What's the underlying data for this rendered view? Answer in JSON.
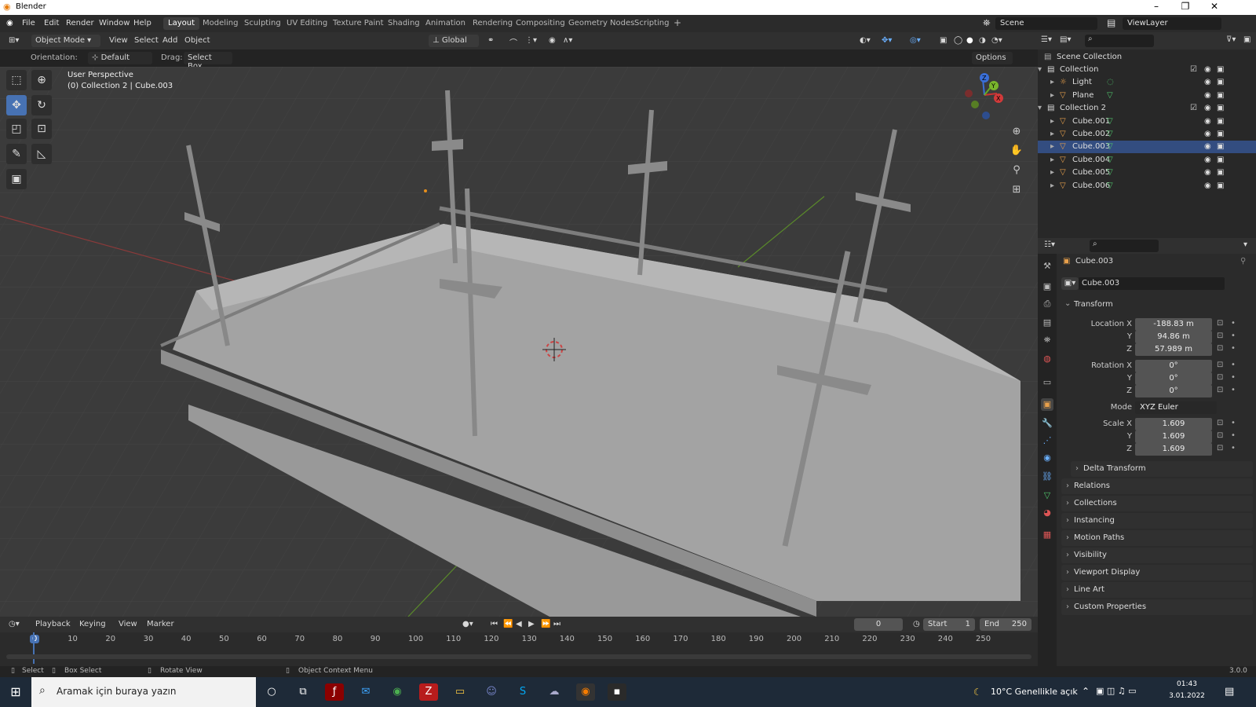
{
  "window": {
    "title": "Blender"
  },
  "menubar": [
    "File",
    "Edit",
    "Render",
    "Window",
    "Help"
  ],
  "workspaces": [
    "Layout",
    "Modeling",
    "Sculpting",
    "UV Editing",
    "Texture Paint",
    "Shading",
    "Animation",
    "Rendering",
    "Compositing",
    "Geometry Nodes",
    "Scripting"
  ],
  "workspace_add": "+",
  "scene": {
    "scene_name": "Scene",
    "view_layer": "ViewLayer"
  },
  "viewport_header": {
    "mode": "Object Mode",
    "menus": [
      "View",
      "Select",
      "Add",
      "Object"
    ],
    "transform_orientation": "Global",
    "orientation_label": "Orientation:",
    "orientation_value": "Default",
    "drag_label": "Drag:",
    "drag_value": "Select Box",
    "options_label": "Options"
  },
  "viewport": {
    "view_name": "User Perspective",
    "context": "(0) Collection 2 | Cube.003"
  },
  "outliner": {
    "root": "Scene Collection",
    "items": [
      {
        "name": "Collection",
        "level": 1,
        "kind": "collection"
      },
      {
        "name": "Light",
        "level": 2,
        "kind": "light"
      },
      {
        "name": "Plane",
        "level": 2,
        "kind": "mesh"
      },
      {
        "name": "Collection 2",
        "level": 1,
        "kind": "collection"
      },
      {
        "name": "Cube.001",
        "level": 2,
        "kind": "mesh"
      },
      {
        "name": "Cube.002",
        "level": 2,
        "kind": "mesh"
      },
      {
        "name": "Cube.003",
        "level": 2,
        "kind": "mesh",
        "selected": true
      },
      {
        "name": "Cube.004",
        "level": 2,
        "kind": "mesh"
      },
      {
        "name": "Cube.005",
        "level": 2,
        "kind": "mesh"
      },
      {
        "name": "Cube.006",
        "level": 2,
        "kind": "mesh"
      }
    ]
  },
  "properties": {
    "object_name": "Cube.003",
    "object_field": "Cube.003",
    "transform_label": "Transform",
    "location": {
      "label": "Location X",
      "x": "-188.83 m",
      "y": "94.86 m",
      "z": "57.989 m"
    },
    "rotation": {
      "label": "Rotation X",
      "x": "0°",
      "y": "0°",
      "z": "0°"
    },
    "mode_label": "Mode",
    "mode_value": "XYZ Euler",
    "scale": {
      "label": "Scale X",
      "x": "1.609",
      "y": "1.609",
      "z": "1.609"
    },
    "axis_y": "Y",
    "axis_z": "Z",
    "sections": [
      "Delta Transform",
      "Relations",
      "Collections",
      "Instancing",
      "Motion Paths",
      "Visibility",
      "Viewport Display",
      "Line Art",
      "Custom Properties"
    ]
  },
  "timeline": {
    "menus": [
      "Playback",
      "Keying",
      "View",
      "Marker"
    ],
    "current_frame": "0",
    "start_label": "Start",
    "start": "1",
    "end_label": "End",
    "end": "250",
    "ticks": [
      "0",
      "10",
      "20",
      "30",
      "40",
      "50",
      "60",
      "70",
      "80",
      "90",
      "100",
      "110",
      "120",
      "130",
      "140",
      "150",
      "160",
      "170",
      "180",
      "190",
      "200",
      "210",
      "220",
      "230",
      "240",
      "250"
    ]
  },
  "statusbar": {
    "hints": [
      "Select",
      "Box Select",
      "Rotate View",
      "Object Context Menu"
    ],
    "version": "3.0.0"
  },
  "taskbar": {
    "search_placeholder": "Aramak için buraya yazın",
    "weather": "10°C  Genellikle açık",
    "time": "01:43",
    "date": "3.01.2022"
  }
}
